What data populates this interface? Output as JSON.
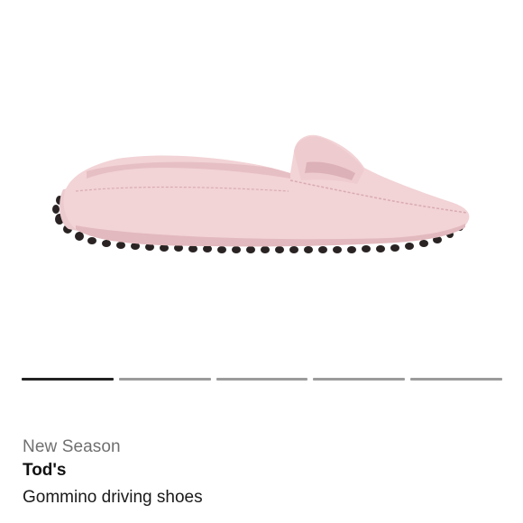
{
  "product": {
    "image_alt": "Pink leather penny loafer driving shoe",
    "season_label": "New Season",
    "brand": "Tod's",
    "name": "Gommino driving shoes"
  },
  "carousel": {
    "total_slides": 5,
    "active_index": 0
  },
  "colors": {
    "shoe": "#f2d3d6",
    "shoe_shadow": "#e2b9be",
    "pebbles": "#2a2323",
    "active_dot": "#222222",
    "inactive_dot": "#9b9b9b"
  }
}
